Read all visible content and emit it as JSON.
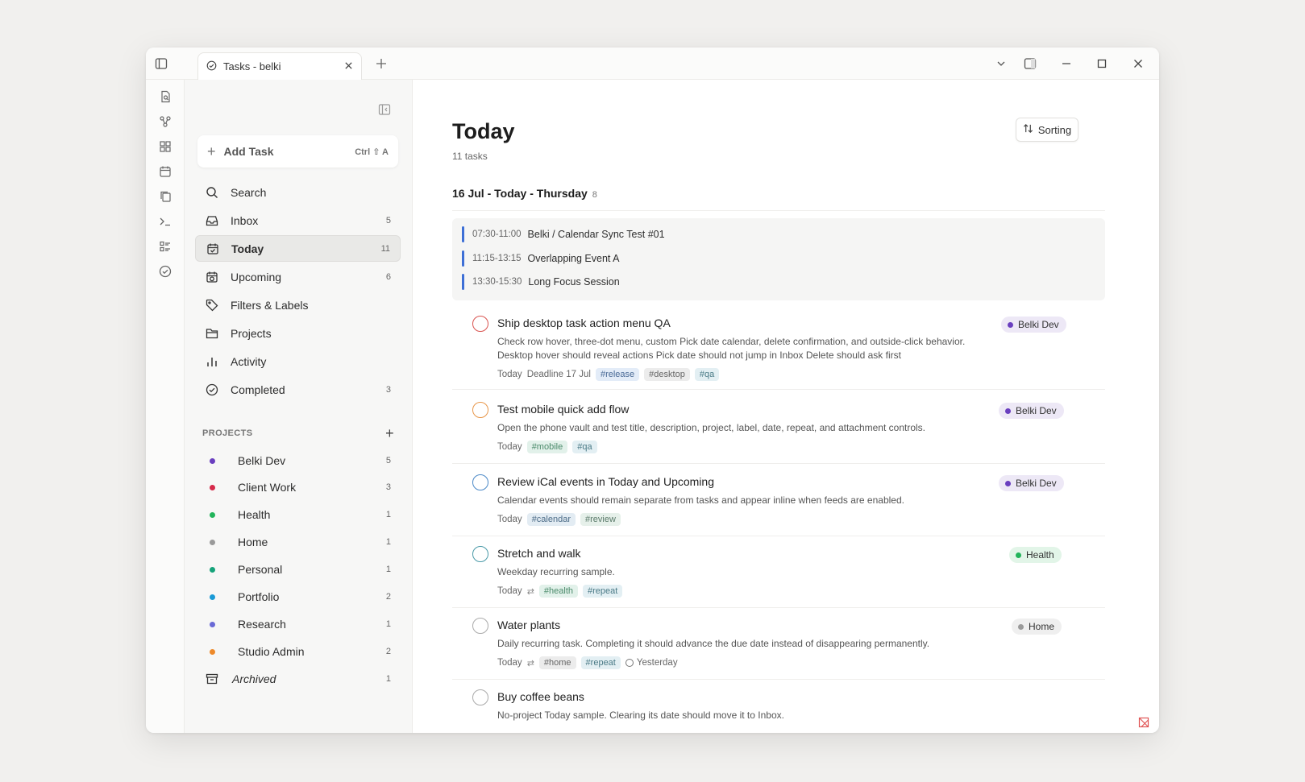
{
  "window": {
    "tab_title": "Tasks - belki",
    "new_tab_label": "+"
  },
  "sidebar": {
    "add_task": {
      "label": "Add Task",
      "shortcut": "Ctrl ⇧ A"
    },
    "nav": [
      {
        "id": "search",
        "label": "Search",
        "count": "",
        "icon": "search-icon"
      },
      {
        "id": "inbox",
        "label": "Inbox",
        "count": "5",
        "icon": "inbox-icon"
      },
      {
        "id": "today",
        "label": "Today",
        "count": "11",
        "icon": "calendar-check-icon",
        "active": true
      },
      {
        "id": "upcoming",
        "label": "Upcoming",
        "count": "6",
        "icon": "calendar-clock-icon"
      },
      {
        "id": "filters",
        "label": "Filters & Labels",
        "count": "",
        "icon": "tag-icon"
      },
      {
        "id": "projects",
        "label": "Projects",
        "count": "",
        "icon": "folder-icon"
      },
      {
        "id": "activity",
        "label": "Activity",
        "count": "",
        "icon": "bar-chart-icon"
      },
      {
        "id": "completed",
        "label": "Completed",
        "count": "3",
        "icon": "check-circle-icon"
      }
    ],
    "projects_header": "PROJECTS",
    "projects": [
      {
        "label": "Belki Dev",
        "count": "5",
        "color": "#6a3fbf"
      },
      {
        "label": "Client Work",
        "count": "3",
        "color": "#d62a4a"
      },
      {
        "label": "Health",
        "count": "1",
        "color": "#22b45a"
      },
      {
        "label": "Home",
        "count": "1",
        "color": "#9a9a9a"
      },
      {
        "label": "Personal",
        "count": "1",
        "color": "#16a37a"
      },
      {
        "label": "Portfolio",
        "count": "2",
        "color": "#1a9ad6"
      },
      {
        "label": "Research",
        "count": "1",
        "color": "#6a6ad6"
      },
      {
        "label": "Studio Admin",
        "count": "2",
        "color": "#ee8a2a"
      },
      {
        "label": "Archived",
        "count": "1",
        "color": "",
        "archived": true
      }
    ]
  },
  "main": {
    "title": "Today",
    "subtitle": "11 tasks",
    "sorting_label": "Sorting",
    "section": {
      "title": "16 Jul - Today - Thursday",
      "count": "8"
    },
    "events": [
      {
        "time": "07:30-11:00",
        "title": "Belki / Calendar Sync Test #01"
      },
      {
        "time": "11:15-13:15",
        "title": "Overlapping Event A"
      },
      {
        "time": "13:30-15:30",
        "title": "Long Focus Session"
      }
    ],
    "tasks": [
      {
        "title": "Ship desktop task action menu QA",
        "desc1": "Check row hover, three-dot menu, custom Pick date calendar, delete confirmation, and outside-click behavior.",
        "desc2": "Desktop hover should reveal actions Pick date should not jump in Inbox Delete should ask first",
        "date": "Today",
        "deadline": "Deadline 17 Jul",
        "tags": [
          "#release",
          "#desktop",
          "#qa"
        ],
        "project": "Belki Dev",
        "priority_color": "#d9534f"
      },
      {
        "title": "Test mobile quick add flow",
        "desc1": "Open the phone vault and test title, description, project, label, date, repeat, and attachment controls.",
        "date": "Today",
        "tags": [
          "#mobile",
          "#qa"
        ],
        "project": "Belki Dev",
        "priority_color": "#e8974a"
      },
      {
        "title": "Review iCal events in Today and Upcoming",
        "desc1": "Calendar events should remain separate from tasks and appear inline when feeds are enabled.",
        "date": "Today",
        "tags": [
          "#calendar",
          "#review"
        ],
        "project": "Belki Dev",
        "priority_color": "#4a88c7"
      },
      {
        "title": "Stretch and walk",
        "desc1": "Weekday recurring sample.",
        "date": "Today",
        "tags": [
          "#health",
          "#repeat"
        ],
        "project": "Health",
        "priority_color": "#4a9aa8"
      },
      {
        "title": "Water plants",
        "desc1": "Daily recurring task. Completing it should advance the due date instead of disappearing permanently.",
        "date": "Today",
        "tags": [
          "#home",
          "#repeat"
        ],
        "overdue": "Yesterday",
        "project": "Home",
        "priority_color": "#aaaaaa"
      },
      {
        "title": "Buy coffee beans",
        "desc1": "No-project Today sample. Clearing its date should move it to Inbox.",
        "priority_color": "#aaaaaa"
      }
    ]
  }
}
